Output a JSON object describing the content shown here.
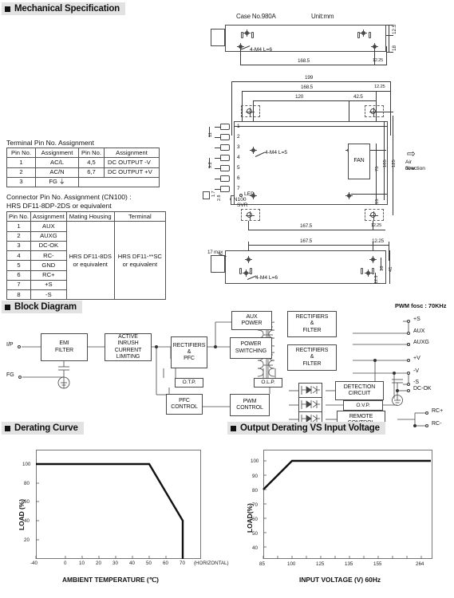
{
  "sections": {
    "mechanical": "Mechanical Specification",
    "block": "Block Diagram",
    "derating": "Derating Curve",
    "output_derating": "Output Derating VS Input Voltage"
  },
  "mechanical": {
    "case_no": "Case No.980A",
    "unit": "Unit:mm",
    "screw_top": "4-M4 L=6",
    "screw_mid": "4-M4 L=5",
    "screw_bottom": "4-M4 L=6",
    "airflow": "Air flow\ndirection",
    "airflow_line1": "Air flow",
    "airflow_line2": "direction",
    "fan": "FAN",
    "led": "LED",
    "cn100": "CN100",
    "svr": "SVR",
    "max17": "17 max",
    "dims_top": [
      "12.5",
      "18",
      "168.5",
      "12.25"
    ],
    "dims_mid": [
      "199",
      "168.5",
      "12.25",
      "120",
      "42.5",
      "11",
      "9.2",
      "1.7",
      "2.8",
      "75",
      "105",
      "125",
      "15",
      "167.5",
      "12.25"
    ],
    "dims_bottom": [
      "167.5",
      "12.25",
      "18",
      "41",
      "12.5"
    ],
    "pin_numbers": [
      "1",
      "2",
      "3",
      "4",
      "5",
      "6",
      "7"
    ]
  },
  "terminal_table": {
    "title": "Terminal Pin No.  Assignment",
    "headers": [
      "Pin No.",
      "Assignment",
      "Pin No.",
      "Assignment"
    ],
    "rows": [
      [
        "1",
        "AC/L",
        "4,5",
        "DC OUTPUT -V"
      ],
      [
        "2",
        "AC/N",
        "6,7",
        "DC OUTPUT +V"
      ],
      [
        "3",
        "FG  ⏚",
        "",
        ""
      ]
    ]
  },
  "connector_table": {
    "title_line1": "Connector Pin No. Assignment (CN100) :",
    "title_line2": "HRS DF11-8DP-2DS or equivalent",
    "headers": [
      "Pin No.",
      "Assignment",
      "Mating Housing",
      "Terminal"
    ],
    "rows": [
      [
        "1",
        "AUX"
      ],
      [
        "2",
        "AUXG"
      ],
      [
        "3",
        "DC-OK"
      ],
      [
        "4",
        "RC-"
      ],
      [
        "5",
        "GND"
      ],
      [
        "6",
        "RC+"
      ],
      [
        "7",
        "+S"
      ],
      [
        "8",
        "-S"
      ]
    ],
    "mating_housing": "HRS DF11-8DS\nor equivalent",
    "mating_housing_l1": "HRS DF11-8DS",
    "mating_housing_l2": "or equivalent",
    "terminal": "HRS DF11-**SC\nor equivalent",
    "terminal_l1": "HRS DF11-**SC",
    "terminal_l2": "or equivalent"
  },
  "block_diagram": {
    "pwm_note": "PWM  fosc : 70KHz",
    "input_label": "I/P",
    "fg_label": "FG",
    "boxes": {
      "emi": "EMI\nFILTER",
      "emi_l1": "EMI",
      "emi_l2": "FILTER",
      "inrush_l1": "ACTIVE",
      "inrush_l2": "INRUSH",
      "inrush_l3": "CURRENT",
      "inrush_l4": "LIMITING",
      "rect_pfc_l1": "RECTIFIERS",
      "rect_pfc_l2": "&",
      "rect_pfc_l3": "PFC",
      "otp": "O.T.P.",
      "pfc_ctrl_l1": "PFC",
      "pfc_ctrl_l2": "CONTROL",
      "aux_power_l1": "AUX",
      "aux_power_l2": "POWER",
      "power_sw_l1": "POWER",
      "power_sw_l2": "SWITCHING",
      "olp": "O.L.P.",
      "pwm_ctrl_l1": "PWM",
      "pwm_ctrl_l2": "CONTROL",
      "rect_filter1_l1": "RECTIFIERS",
      "rect_filter1_l2": "&",
      "rect_filter1_l3": "FILTER",
      "rect_filter2_l1": "RECTIFIERS",
      "rect_filter2_l2": "&",
      "rect_filter2_l3": "FILTER",
      "detection_l1": "DETECTION",
      "detection_l2": "CIRCUIT",
      "ovp": "O.V.P.",
      "remote_l1": "REMOTE",
      "remote_l2": "CONTROL"
    },
    "outputs": [
      "AUX",
      "AUXG",
      "+S",
      "+V",
      "-V",
      "-S",
      "DC-OK",
      "RC+",
      "RC-"
    ]
  },
  "chart_data": [
    {
      "type": "line",
      "title": "Derating Curve",
      "xlabel": "AMBIENT TEMPERATURE (℃)",
      "ylabel": "LOAD (%)",
      "xticks": [
        "-40",
        "0",
        "10",
        "20",
        "30",
        "40",
        "50",
        "60",
        "70"
      ],
      "xtick_values": [
        -40,
        0,
        10,
        20,
        30,
        40,
        50,
        60,
        70
      ],
      "yticks": [
        "20",
        "40",
        "60",
        "80",
        "100"
      ],
      "ytick_values": [
        20,
        40,
        60,
        80,
        100
      ],
      "xlim": [
        -40,
        75
      ],
      "ylim": [
        0,
        110
      ],
      "note": "(HORIZONTAL)",
      "grid": false,
      "series": [
        {
          "name": "load-vs-temperature",
          "x": [
            -40,
            50,
            70,
            70
          ],
          "y": [
            100,
            100,
            50,
            0
          ]
        }
      ]
    },
    {
      "type": "line",
      "title": "Output Derating VS Input Voltage",
      "xlabel": "INPUT VOLTAGE (V) 60Hz",
      "ylabel": "LOAD(%)",
      "xticks": [
        "85",
        "100",
        "125",
        "135",
        "155",
        "264"
      ],
      "xtick_values": [
        85,
        100,
        125,
        135,
        155,
        264
      ],
      "yticks": [
        "40",
        "50",
        "60",
        "70",
        "80",
        "90",
        "100"
      ],
      "ytick_values": [
        40,
        50,
        60,
        70,
        80,
        90,
        100
      ],
      "xlim": [
        85,
        280
      ],
      "ylim": [
        30,
        105
      ],
      "grid": false,
      "series": [
        {
          "name": "load-vs-input-voltage",
          "x": [
            85,
            100,
            280
          ],
          "y": [
            80,
            100,
            100
          ]
        }
      ]
    }
  ]
}
